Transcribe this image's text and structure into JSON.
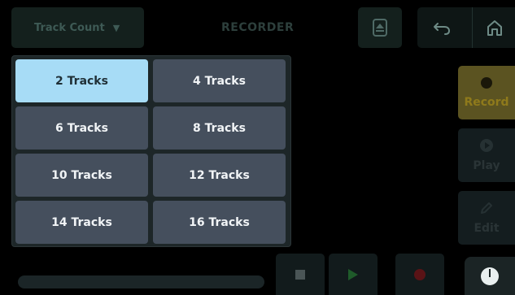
{
  "header": {
    "track_count_label": "Track Count",
    "title": "RECORDER"
  },
  "track_options": [
    {
      "label": "2 Tracks",
      "selected": true
    },
    {
      "label": "4 Tracks",
      "selected": false
    },
    {
      "label": "6 Tracks",
      "selected": false
    },
    {
      "label": "8 Tracks",
      "selected": false
    },
    {
      "label": "10 Tracks",
      "selected": false
    },
    {
      "label": "12 Tracks",
      "selected": false
    },
    {
      "label": "14 Tracks",
      "selected": false
    },
    {
      "label": "16 Tracks",
      "selected": false
    }
  ],
  "side": {
    "record_label": "Record",
    "play_label": "Play",
    "edit_label": "Edit"
  },
  "icons": {
    "dropdown": "chevron-down-icon",
    "eject": "eject-icon",
    "undo": "undo-icon",
    "home": "home-icon",
    "stop": "stop-icon",
    "play": "play-icon",
    "record": "record-icon",
    "meter": "meter-icon"
  },
  "colors": {
    "selected_tile": "#a7dcf6",
    "tile": "#454f5d",
    "record_accent": "#8f7a1b",
    "play_green": "#1f5b2a",
    "record_red": "#5a1316"
  }
}
